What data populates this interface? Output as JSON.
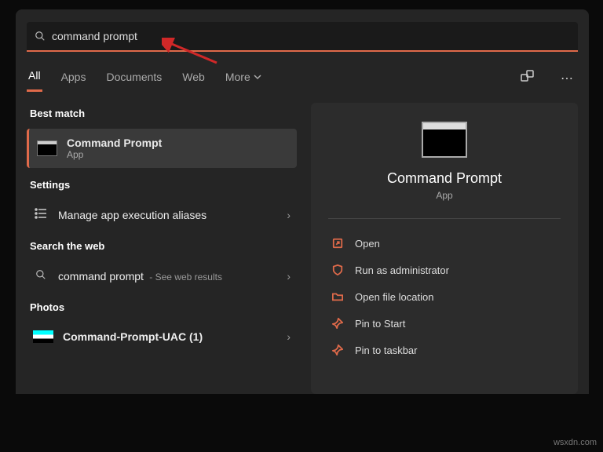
{
  "search": {
    "value": "command prompt"
  },
  "tabs": {
    "all": "All",
    "apps": "Apps",
    "documents": "Documents",
    "web": "Web",
    "more": "More"
  },
  "sections": {
    "best_match": "Best match",
    "settings": "Settings",
    "search_web": "Search the web",
    "photos": "Photos"
  },
  "best_match": {
    "title": "Command Prompt",
    "subtitle": "App"
  },
  "settings_row": {
    "label": "Manage app execution aliases"
  },
  "web_row": {
    "label": "command prompt",
    "suffix": " - See web results"
  },
  "photos_row": {
    "label": "Command-Prompt-UAC (1)"
  },
  "preview": {
    "title": "Command Prompt",
    "subtitle": "App",
    "actions": {
      "open": "Open",
      "admin": "Run as administrator",
      "location": "Open file location",
      "pin_start": "Pin to Start",
      "pin_taskbar": "Pin to taskbar"
    }
  },
  "watermark": "wsxdn.com"
}
